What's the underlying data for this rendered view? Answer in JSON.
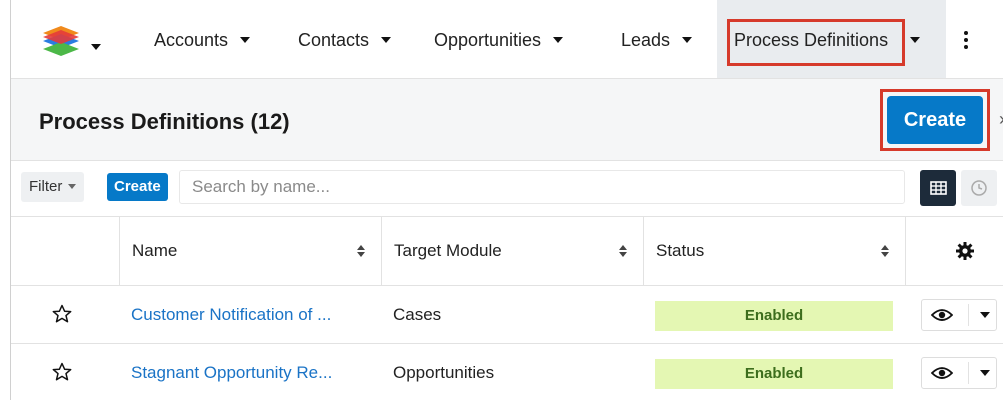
{
  "nav": {
    "logo_icon": "sugar-cube-logo-icon",
    "items": [
      {
        "label": "Accounts"
      },
      {
        "label": "Contacts"
      },
      {
        "label": "Opportunities"
      },
      {
        "label": "Leads"
      },
      {
        "label": "Process Definitions"
      }
    ],
    "active_index": 4,
    "highlight_color": "#d63a2b"
  },
  "header": {
    "title": "Process Definitions (12)",
    "create_label": "Create"
  },
  "filterbar": {
    "filter_label": "Filter",
    "create_label": "Create",
    "search_placeholder": "Search by name..."
  },
  "table": {
    "columns": [
      "Name",
      "Target Module",
      "Status"
    ],
    "rows": [
      {
        "name": "Customer Notification of ...",
        "module": "Cases",
        "status": "Enabled"
      },
      {
        "name": "Stagnant Opportunity Re...",
        "module": "Opportunities",
        "status": "Enabled"
      }
    ]
  },
  "colors": {
    "accent": "#0679c8",
    "link": "#1a73c6",
    "status_enabled_bg": "#e4f7b3",
    "status_enabled_text": "#3d6e1d"
  }
}
